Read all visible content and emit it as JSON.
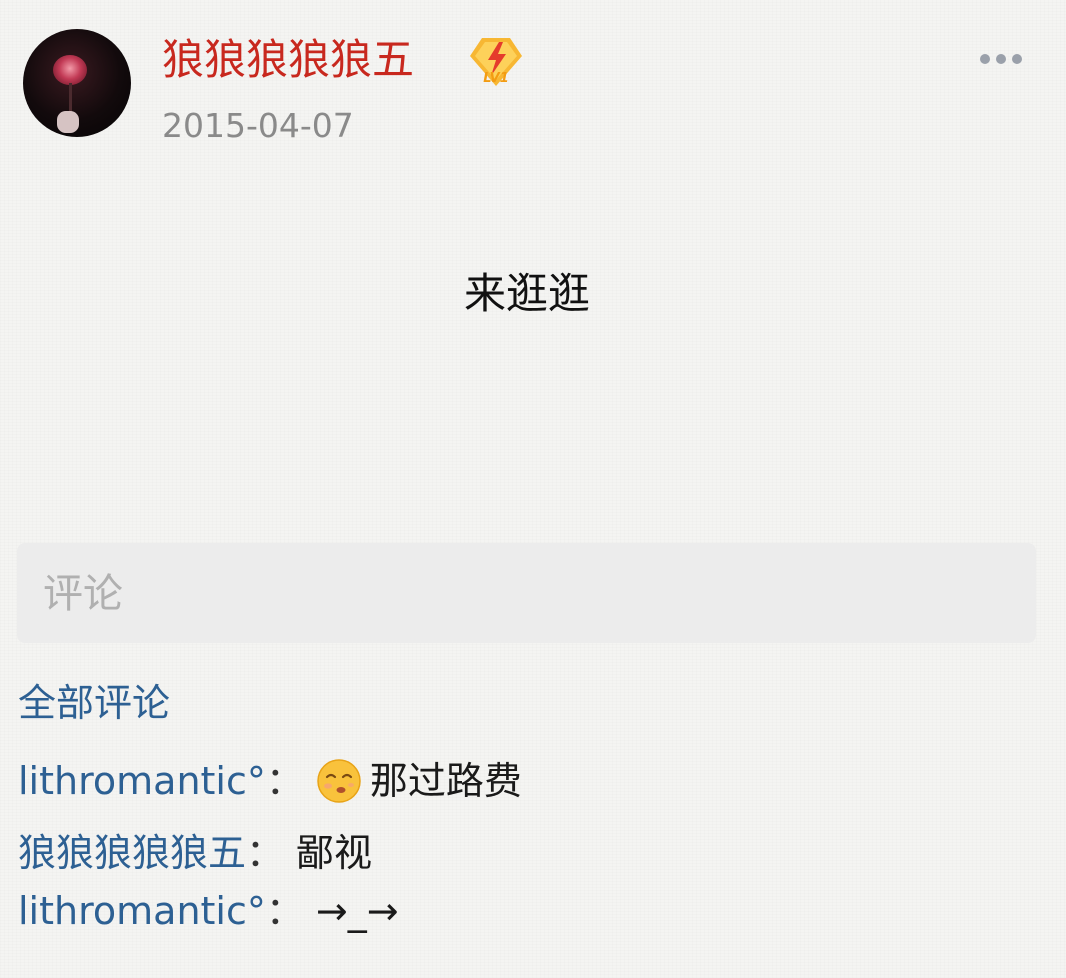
{
  "post": {
    "author": "狼狼狼狼狼五",
    "level_badge_text": "LV1",
    "date": "2015-04-07",
    "content": "来逛逛"
  },
  "actions": {
    "more_icon": "more-horizontal-icon"
  },
  "comment_input": {
    "placeholder": "评论"
  },
  "comments_section": {
    "title": "全部评论",
    "separator": "：",
    "items": [
      {
        "author": "lithromantic°",
        "emoji": "kissing-face-emoji",
        "text": "那过路费"
      },
      {
        "author": "狼狼狼狼狼五",
        "text": "鄙视"
      },
      {
        "author": "lithromantic°",
        "text": "→_→"
      }
    ]
  },
  "colors": {
    "username": "#c8281e",
    "link": "#2d6093",
    "date": "#8a8a8a",
    "placeholder": "#b0b0b0",
    "badge": "#f5a623"
  }
}
